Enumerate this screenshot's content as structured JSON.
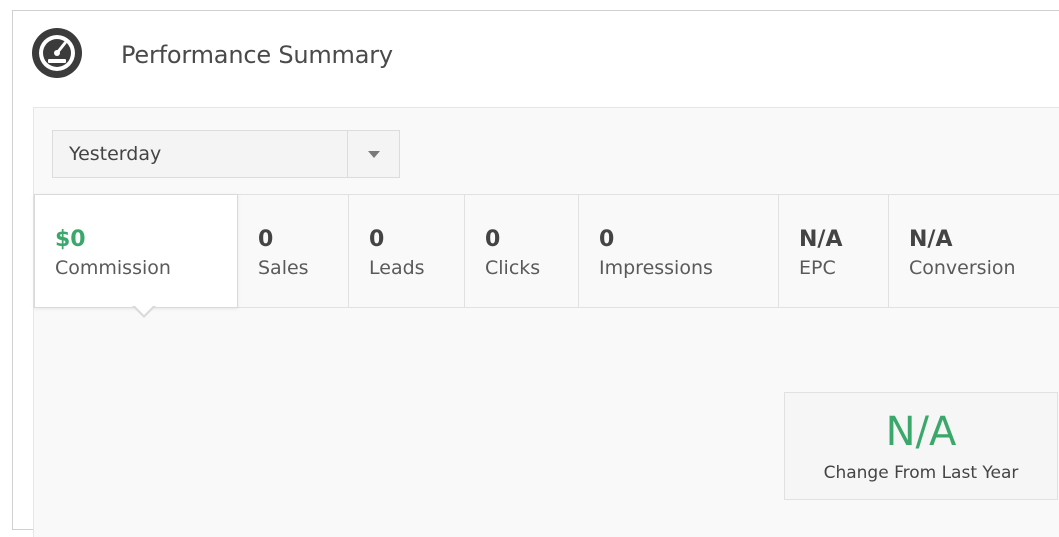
{
  "header": {
    "title": "Performance Summary",
    "icon": "speedometer-icon"
  },
  "filter": {
    "selected": "Yesterday",
    "arrow_icon": "chevron-down-icon"
  },
  "metrics": [
    {
      "value": "$0",
      "label": "Commission",
      "active": true
    },
    {
      "value": "0",
      "label": "Sales"
    },
    {
      "value": "0",
      "label": "Leads"
    },
    {
      "value": "0",
      "label": "Clicks"
    },
    {
      "value": "0",
      "label": "Impressions"
    },
    {
      "value": "N/A",
      "label": "EPC"
    },
    {
      "value": "N/A",
      "label": "Conversion"
    }
  ],
  "change": {
    "value": "N/A",
    "label": "Change From Last Year"
  },
  "colors": {
    "accent_green": "#3aa86b",
    "text": "#444444",
    "border": "#e1e1e1"
  }
}
